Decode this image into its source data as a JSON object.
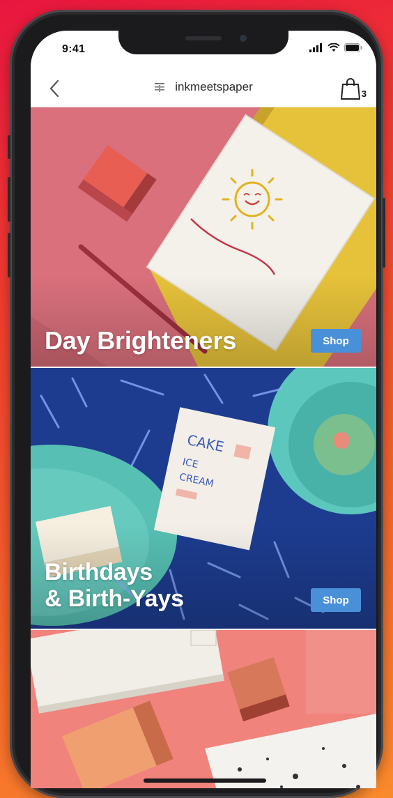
{
  "status_bar": {
    "time": "9:41"
  },
  "navbar": {
    "title": "inkmeetspaper",
    "bag_count": "3"
  },
  "collections": [
    {
      "title_line1": "Day Brighteners",
      "title_line2": "",
      "shop_label": "Shop"
    },
    {
      "title_line1": "Birthdays",
      "title_line2": "& Birth-Yays",
      "shop_label": "Shop"
    }
  ],
  "colors": {
    "shop_button": "#4a90d9",
    "background_start": "#e8163f",
    "background_end": "#f98a2c"
  }
}
